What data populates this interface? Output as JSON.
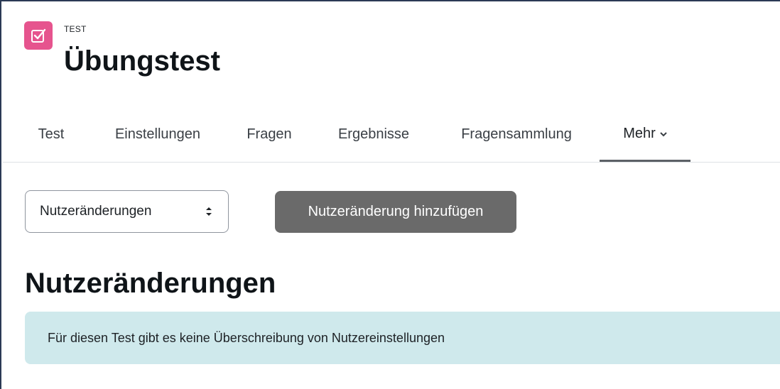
{
  "header": {
    "module_label": "TEST",
    "title": "Übungstest",
    "icon": "test-checkbox-icon",
    "icon_color": "#e6548e"
  },
  "nav": {
    "tabs": [
      {
        "label": "Test"
      },
      {
        "label": "Einstellungen"
      },
      {
        "label": "Fragen"
      },
      {
        "label": "Ergebnisse"
      },
      {
        "label": "Fragensammlung"
      },
      {
        "label": "Mehr",
        "active": true
      }
    ],
    "more_chevron": "⌄"
  },
  "toolbar": {
    "select_value": "Nutzeränderungen",
    "add_button_label": "Nutzeränderung hinzufügen",
    "button_color": "#6a6a6a"
  },
  "main": {
    "heading": "Nutzeränderungen",
    "notice": "Für diesen Test gibt es keine Überschreibung von Nutzereinstellungen",
    "notice_color": "#cfe9ec"
  }
}
